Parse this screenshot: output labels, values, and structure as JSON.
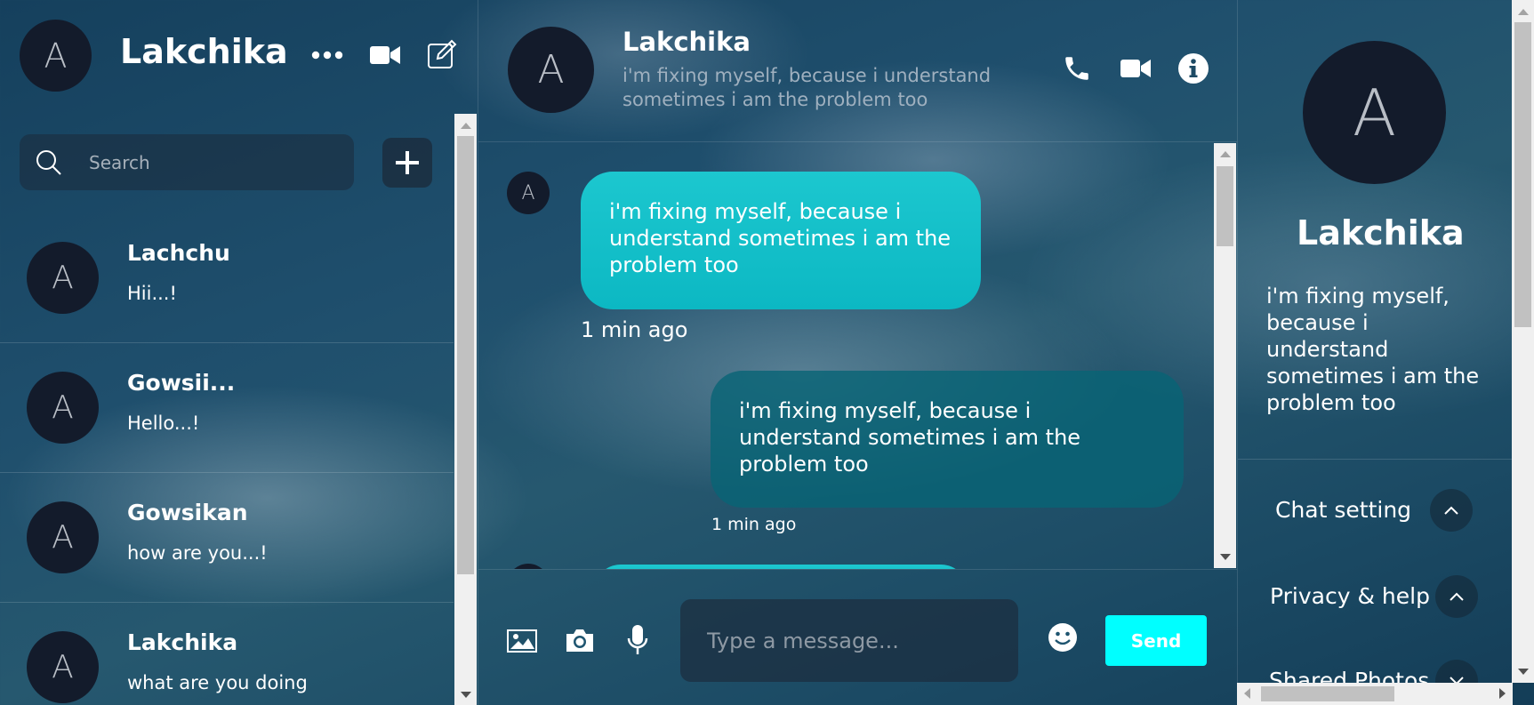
{
  "user": {
    "avatar_letter": "A",
    "name": "Lakchika"
  },
  "search": {
    "placeholder": "Search"
  },
  "contacts": [
    {
      "avatar_letter": "A",
      "name": "Lachchu",
      "last_message": "Hii...!"
    },
    {
      "avatar_letter": "A",
      "name": "Gowsii...",
      "last_message": "Hello...!"
    },
    {
      "avatar_letter": "A",
      "name": "Gowsikan",
      "last_message": "how are you...!"
    },
    {
      "avatar_letter": "A",
      "name": "Lakchika",
      "last_message": "what are you doing"
    }
  ],
  "chat": {
    "avatar_letter": "A",
    "name": "Lakchika",
    "status": "i'm fixing myself, because i understand sometimes i am the problem too",
    "messages": [
      {
        "direction": "incoming",
        "avatar_letter": "A",
        "text": "i'm fixing myself, because i understand sometimes i am the problem too",
        "time": "1 min ago"
      },
      {
        "direction": "outgoing",
        "text": "i'm fixing myself, because i understand sometimes i am the problem too",
        "time": "1 min ago"
      }
    ]
  },
  "composer": {
    "placeholder": "Type a message...",
    "send_label": "Send"
  },
  "profile": {
    "avatar_letter": "A",
    "name": "Lakchika",
    "bio": "i'm fixing myself, because i understand sometimes i am the problem too",
    "sections": [
      {
        "label": "Chat setting",
        "expanded": true
      },
      {
        "label": "Privacy & help",
        "expanded": true
      },
      {
        "label": "Shared Photos",
        "expanded": false
      }
    ]
  },
  "colors": {
    "accent": "#00ffff",
    "incoming_bubble": "#14c0ca",
    "outgoing_bubble": "#0a6476",
    "avatar_bg": "#131b2b"
  }
}
